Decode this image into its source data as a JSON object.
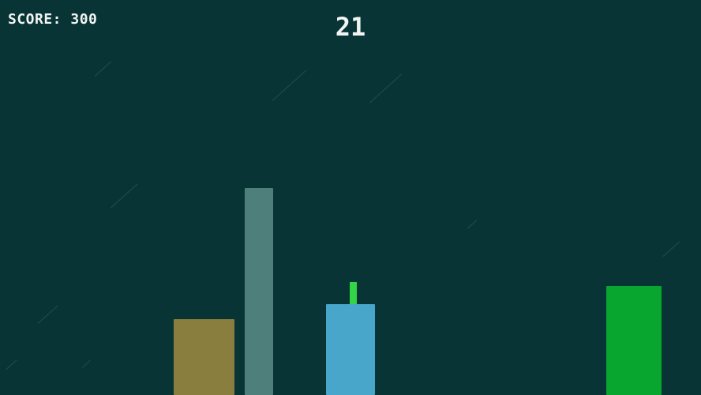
{
  "hud": {
    "score_text": "SCORE: 300",
    "timer_text": "21"
  },
  "colors": {
    "background": "#083436",
    "olive_platform": "#8a7e3e",
    "gray_platform": "#4f7f7a",
    "blue_platform": "#47a6c9",
    "green_platform": "#08a62e",
    "player": "#33d447"
  }
}
